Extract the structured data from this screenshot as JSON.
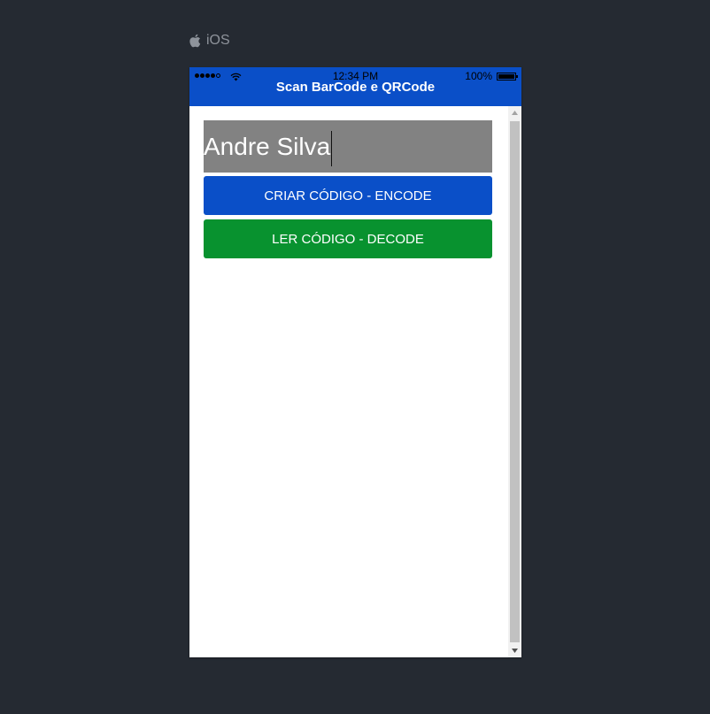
{
  "platform": {
    "label": "iOS",
    "icon": "apple-icon"
  },
  "status_bar": {
    "time": "12:34 PM",
    "battery": "100%",
    "signal_bars": 4,
    "signal_total": 5
  },
  "navbar": {
    "title": "Scan BarCode e QRCode",
    "color": "#0a4fc8"
  },
  "form": {
    "name_value": "Andre Silva",
    "encode_label": "CRIAR CÓDIGO - ENCODE",
    "decode_label": "LER CÓDIGO - DECODE",
    "encode_color": "#0a4fc8",
    "decode_color": "#08922f"
  }
}
